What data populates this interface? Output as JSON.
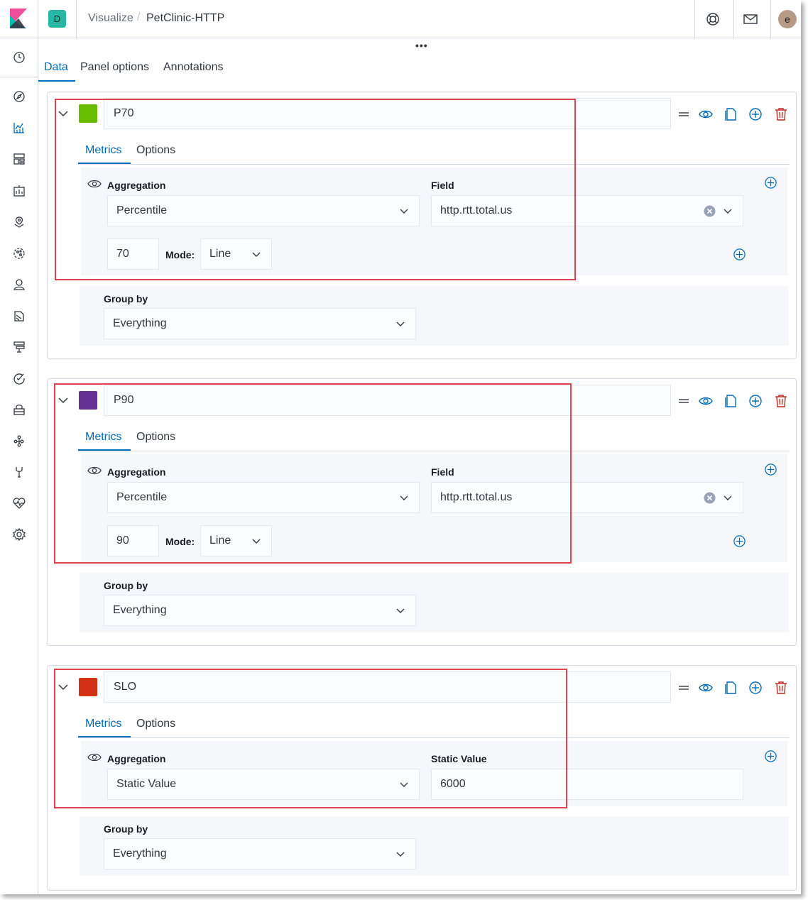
{
  "header": {
    "space_initial": "D",
    "breadcrumb_parent": "Visualize",
    "breadcrumb_separator": "/",
    "breadcrumb_current": "PetClinic-HTTP",
    "user_initial": "e",
    "icons": [
      "help-icon",
      "mail-icon"
    ]
  },
  "nav": {
    "icons": [
      "clock-icon",
      "discover-icon",
      "visualize-icon",
      "dashboard-icon",
      "canvas-icon",
      "maps-icon",
      "ml-icon",
      "infrastructure-icon",
      "logs-icon",
      "apm-icon",
      "uptime-icon",
      "siem-icon",
      "graph-icon",
      "devtools-icon",
      "monitoring-icon",
      "management-icon"
    ]
  },
  "toolbar": {
    "more": "•••"
  },
  "tabs": [
    "Data",
    "Panel options",
    "Annotations"
  ],
  "active_tab": "Data",
  "colors": {
    "accent": "#006bb8",
    "highlight": "#e0424f"
  },
  "series": [
    {
      "label": "P70",
      "color": "#68bc00",
      "subtabs": [
        "Metrics",
        "Options"
      ],
      "aggregation_label": "Aggregation",
      "aggregation": "Percentile",
      "field_label": "Field",
      "field": "http.rtt.total.us",
      "percentile": "70",
      "mode_label": "Mode:",
      "mode": "Line",
      "group_by_label": "Group by",
      "group_by": "Everything"
    },
    {
      "label": "P90",
      "color": "#653294",
      "subtabs": [
        "Metrics",
        "Options"
      ],
      "aggregation_label": "Aggregation",
      "aggregation": "Percentile",
      "field_label": "Field",
      "field": "http.rtt.total.us",
      "percentile": "90",
      "mode_label": "Mode:",
      "mode": "Line",
      "group_by_label": "Group by",
      "group_by": "Everything"
    },
    {
      "label": "SLO",
      "color": "#d33115",
      "subtabs": [
        "Metrics",
        "Options"
      ],
      "aggregation_label": "Aggregation",
      "aggregation": "Static Value",
      "field_label": "Static Value",
      "field": "6000",
      "group_by_label": "Group by",
      "group_by": "Everything"
    }
  ]
}
